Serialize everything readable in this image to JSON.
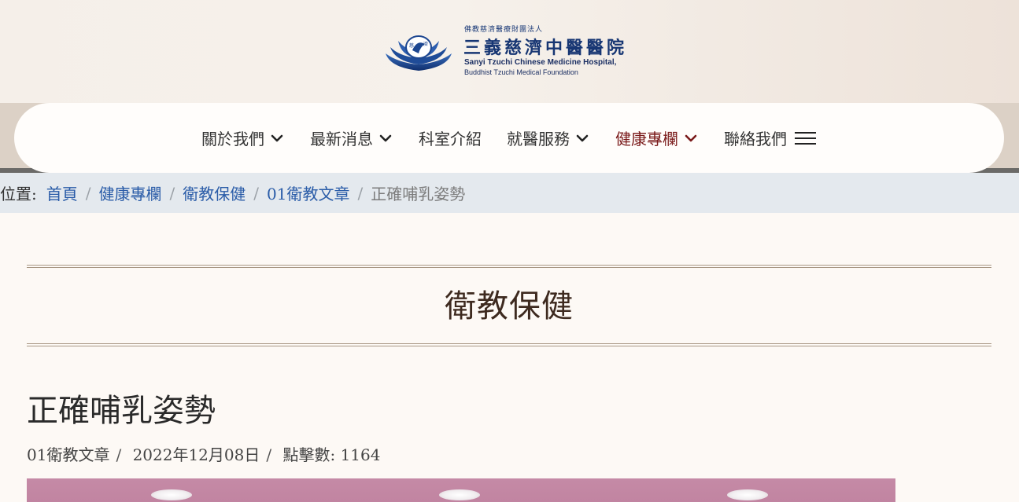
{
  "header": {
    "logo": {
      "top_text": "佛教慈濟醫療財團法人",
      "name_zh": "三義慈濟中醫醫院",
      "name_en_line1": "Sanyi Tzuchi Chinese Medicine Hospital,",
      "name_en_line2": "Buddhist Tzuchi Medical Foundation",
      "emblem_icon": "lotus-emblem-icon"
    }
  },
  "nav": {
    "items": [
      {
        "label": "關於我們",
        "has_dropdown": true
      },
      {
        "label": "最新消息",
        "has_dropdown": true
      },
      {
        "label": "科室介紹",
        "has_dropdown": false
      },
      {
        "label": "就醫服務",
        "has_dropdown": true
      },
      {
        "label": "健康專欄",
        "has_dropdown": true,
        "active": true
      },
      {
        "label": "聯絡我們",
        "has_dropdown": false
      }
    ],
    "menu_icon": "hamburger-menu-icon",
    "active_color": "#7a1a1a"
  },
  "breadcrumb": {
    "prefix": "前位置:",
    "links": [
      "首頁",
      "健康專欄",
      "衛教保健",
      "01衛教文章"
    ],
    "current": "正確哺乳姿勢",
    "separator": "/"
  },
  "section": {
    "title": "衛教保健"
  },
  "article": {
    "title": "正確哺乳姿勢",
    "category": "01衛教文章",
    "date": "2022年12月08日",
    "hits_label": "點擊數:",
    "hits_value": "1164",
    "separator": "/"
  },
  "colors": {
    "brand_blue": "#173673",
    "link_blue": "#2a5ca8",
    "title_brown": "#3e2a1f",
    "image_pink": "#c58aa6"
  }
}
